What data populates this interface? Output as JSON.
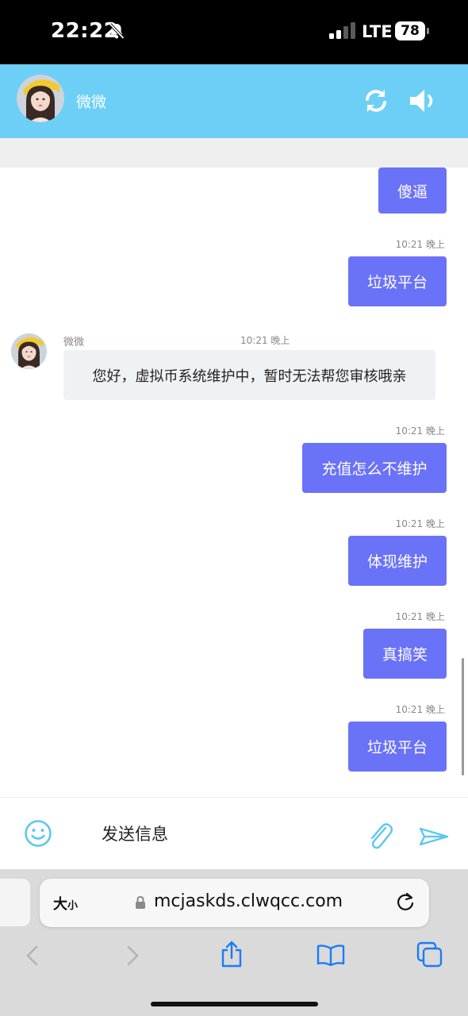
{
  "status_bar": {
    "time": "22:22",
    "network": "LTE",
    "battery": "78"
  },
  "header": {
    "contact_name": "微微"
  },
  "messages": [
    {
      "dir": "out",
      "text": "傻逼",
      "time": ""
    },
    {
      "dir": "out",
      "text": "垃圾平台",
      "time": "10:21 晚上"
    },
    {
      "dir": "in",
      "sender": "微微",
      "text": "您好，虚拟币系统维护中，暂时无法帮您审核哦亲",
      "time": "10:21 晚上"
    },
    {
      "dir": "out",
      "text": "充值怎么不维护",
      "time": "10:21 晚上"
    },
    {
      "dir": "out",
      "text": "体现维护",
      "time": "10:21 晚上"
    },
    {
      "dir": "out",
      "text": "真搞笑",
      "time": "10:21 晚上"
    },
    {
      "dir": "out",
      "text": "垃圾平台",
      "time": "10:21 晚上"
    }
  ],
  "composer": {
    "placeholder": "发送信息"
  },
  "browser": {
    "text_size_big": "大",
    "text_size_small": "小",
    "url": "mcjaskds.clwqcc.com"
  },
  "icons": {
    "bell": "bell-slash-icon",
    "signal": "signal-bars-icon",
    "refresh": "refresh-icon",
    "speaker": "speaker-icon",
    "emoji": "smiley-icon",
    "attach": "paperclip-icon",
    "send": "paper-plane-icon",
    "lock": "lock-icon",
    "reload": "reload-icon",
    "back": "chevron-left-icon",
    "forward": "chevron-right-icon",
    "share": "share-icon",
    "bookmarks": "book-icon",
    "tabs": "tabs-icon"
  },
  "colors": {
    "header_bg": "#6dcff6",
    "outgoing_bubble": "#6a72f8",
    "incoming_bubble": "#eff2f5",
    "accent_icon": "#5bc8f0",
    "safari_blue": "#1a7cf5"
  }
}
